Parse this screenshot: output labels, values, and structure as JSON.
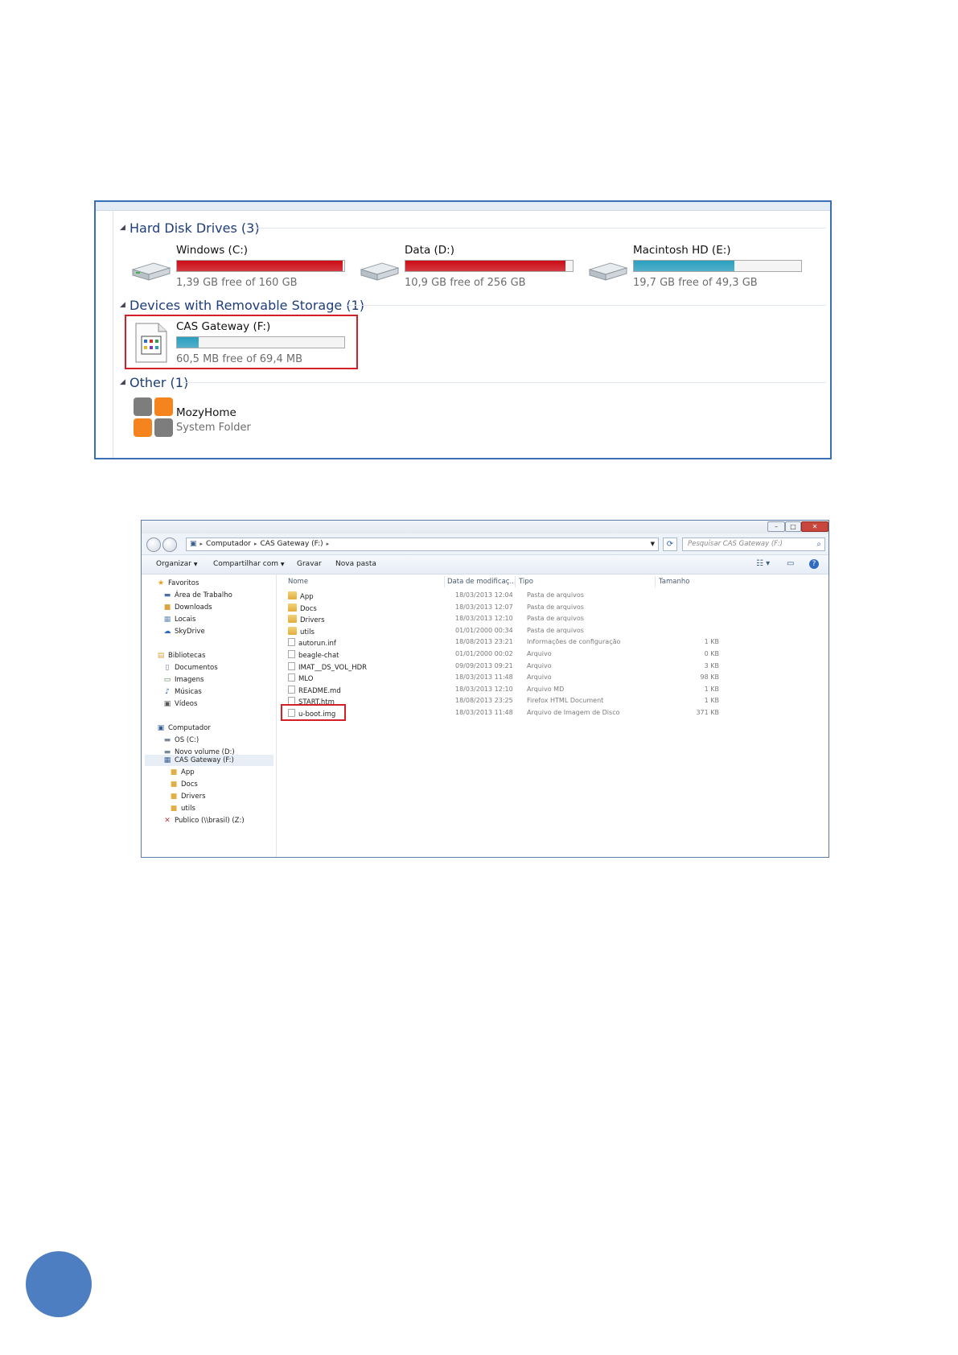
{
  "computer_view": {
    "groups": [
      {
        "title": "Hard Disk Drives (3)"
      },
      {
        "title": "Devices with Removable Storage (1)"
      },
      {
        "title": "Other (1)"
      }
    ],
    "hard_disks": [
      {
        "name": "Windows (C:)",
        "free_text": "1,39 GB free of 160 GB",
        "used_fraction": 0.991,
        "bar_color": "#cc0b15"
      },
      {
        "name": "Data (D:)",
        "free_text": "10,9 GB free of 256 GB",
        "used_fraction": 0.957,
        "bar_color": "#cc0b15"
      },
      {
        "name": "Macintosh HD (E:)",
        "free_text": "19,7 GB free of 49,3 GB",
        "used_fraction": 0.6,
        "bar_color": "#2a9fc0"
      }
    ],
    "removable": {
      "name": "CAS Gateway (F:)",
      "free_text": "60,5 MB free of 69,4 MB",
      "used_fraction": 0.128,
      "bar_color": "#2a9fc0"
    },
    "other": {
      "name": "MozyHome",
      "subtitle": "System Folder"
    }
  },
  "explorer": {
    "address": {
      "computer": "Computador",
      "drive": "CAS Gateway (F:)"
    },
    "search_placeholder": "Pesquisar CAS Gateway (F:)",
    "toolbar": {
      "organize": "Organizar",
      "share": "Compartilhar com",
      "burn": "Gravar",
      "new_folder": "Nova pasta"
    },
    "nav": {
      "favorites": "Favoritos",
      "desktop": "Área de Trabalho",
      "downloads": "Downloads",
      "places": "Locais",
      "skydrive": "SkyDrive",
      "libraries": "Bibliotecas",
      "documents": "Documentos",
      "images": "Imagens",
      "music": "Músicas",
      "videos": "Vídeos",
      "computer": "Computador",
      "os_c": "OS (C:)",
      "new_volume": "Novo volume (D:)",
      "cas_gateway": "CAS Gateway (F:)",
      "app": "App",
      "docs": "Docs",
      "drivers": "Drivers",
      "utils": "utils",
      "public": "Publico (\\\\brasil) (Z:)"
    },
    "columns": {
      "name": "Nome",
      "date": "Data de modificaç...",
      "type": "Tipo",
      "size": "Tamanho"
    },
    "files": [
      {
        "name": "App",
        "date": "18/03/2013 12:04",
        "type": "Pasta de arquivos",
        "size": "",
        "kind": "folder"
      },
      {
        "name": "Docs",
        "date": "18/03/2013 12:07",
        "type": "Pasta de arquivos",
        "size": "",
        "kind": "folder"
      },
      {
        "name": "Drivers",
        "date": "18/03/2013 12:10",
        "type": "Pasta de arquivos",
        "size": "",
        "kind": "folder"
      },
      {
        "name": "utils",
        "date": "01/01/2000 00:34",
        "type": "Pasta de arquivos",
        "size": "",
        "kind": "folder"
      },
      {
        "name": "autorun.inf",
        "date": "18/08/2013 23:21",
        "type": "Informações de configuração",
        "size": "1 KB",
        "kind": "file"
      },
      {
        "name": "beagle-chat",
        "date": "01/01/2000 00:02",
        "type": "Arquivo",
        "size": "0 KB",
        "kind": "file"
      },
      {
        "name": "IMAT__DS_VOL_HDR",
        "date": "09/09/2013 09:21",
        "type": "Arquivo",
        "size": "3 KB",
        "kind": "file"
      },
      {
        "name": "MLO",
        "date": "18/03/2013 11:48",
        "type": "Arquivo",
        "size": "98 KB",
        "kind": "file"
      },
      {
        "name": "README.md",
        "date": "18/03/2013 12:10",
        "type": "Arquivo MD",
        "size": "1 KB",
        "kind": "file"
      },
      {
        "name": "START.htm",
        "date": "18/08/2013 23:25",
        "type": "Firefox HTML Document",
        "size": "1 KB",
        "kind": "html"
      },
      {
        "name": "u-boot.img",
        "date": "18/03/2013 11:48",
        "type": "Arquivo de Imagem de Disco",
        "size": "371 KB",
        "kind": "file"
      }
    ]
  },
  "colors": {
    "accent": "#4e7ec2",
    "highlight": "#d32027",
    "group_title": "#1e3d7b"
  }
}
